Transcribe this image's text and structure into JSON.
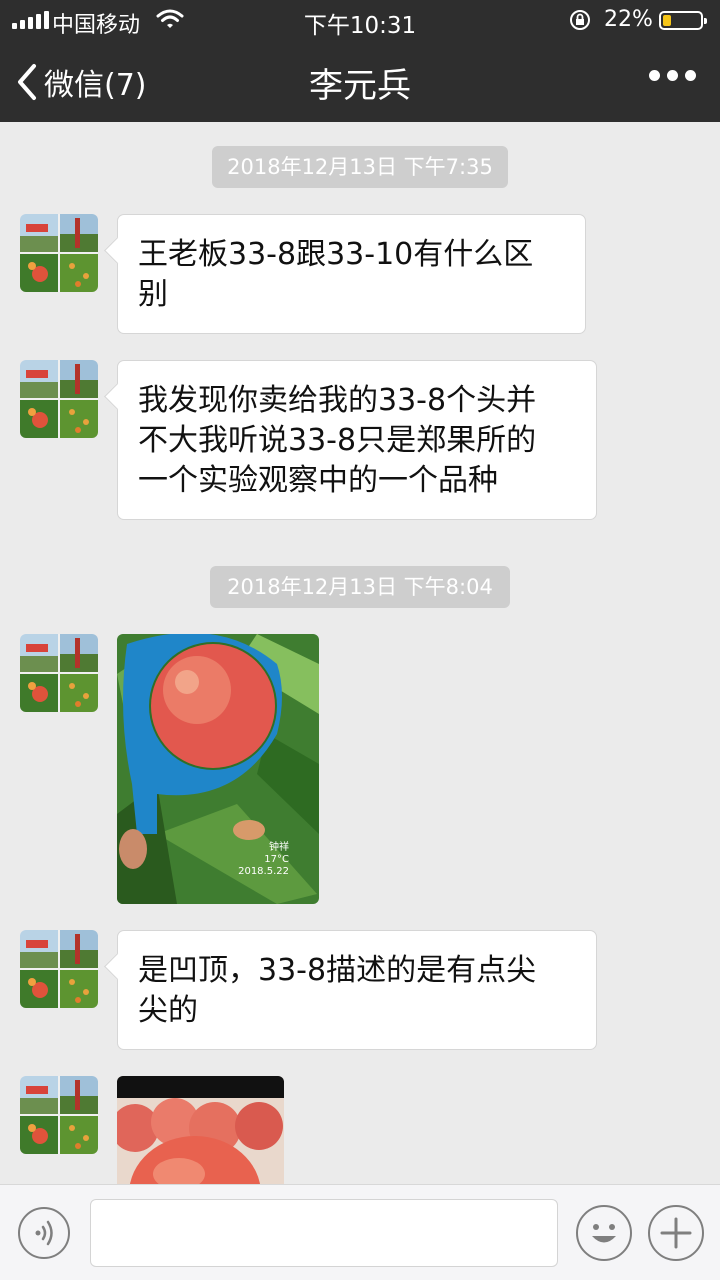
{
  "status_bar": {
    "carrier": "中国移动",
    "time": "下午10:31",
    "battery_percent": "22%",
    "battery_level": 0.22
  },
  "nav": {
    "back_label": "微信(7)",
    "title": "李元兵"
  },
  "messages": [
    {
      "type": "timestamp",
      "text": "2018年12月13日 下午7:35"
    },
    {
      "type": "text",
      "lines": [
        "王老板33-8跟33-10有什么区",
        "别"
      ]
    },
    {
      "type": "text",
      "lines": [
        "我发现你卖给我的33-8个头并",
        "不大我听说33-8只是郑果所的",
        "一个实验观察中的一个品种"
      ]
    },
    {
      "type": "timestamp",
      "text": "2018年12月13日 下午8:04"
    },
    {
      "type": "image",
      "photo_subject": "peach-in-blue-sizing-ring",
      "watermark": {
        "location": "钟祥",
        "temperature": "17°C",
        "date": "2018.5.22"
      }
    },
    {
      "type": "text",
      "lines": [
        "是凹顶，33-8描述的是有点尖",
        "尖的"
      ]
    },
    {
      "type": "image",
      "photo_subject": "peach-cluster"
    }
  ],
  "colors": {
    "header_bg": "#2e2e2e",
    "chat_bg": "#ebebeb",
    "timestamp_bg": "#cecece",
    "bubble_bg": "#ffffff",
    "battery_fill": "#f5c518"
  },
  "input_bar": {
    "placeholder": ""
  },
  "icons": [
    "signal-icon",
    "wifi-icon",
    "orientation-lock-icon",
    "battery-icon",
    "back-chevron-icon",
    "more-icon",
    "voice-icon",
    "emoji-icon",
    "plus-icon"
  ]
}
